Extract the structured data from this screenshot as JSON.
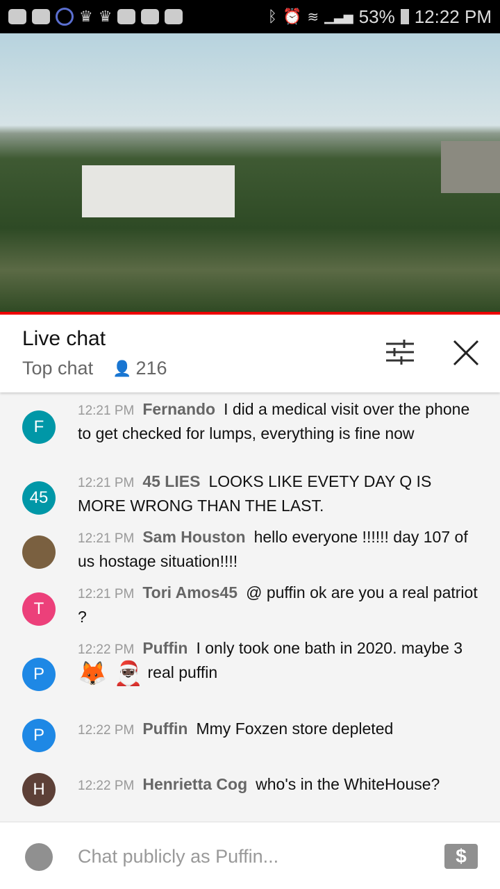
{
  "status_bar": {
    "battery": "53%",
    "time": "12:22 PM",
    "icons": [
      "youtube-icon",
      "alert-icon",
      "pokeball-icon",
      "crown-icon",
      "crown-icon",
      "m-app-icon",
      "youtube-icon",
      "folder-icon",
      "bluetooth-icon",
      "alarm-icon",
      "wifi-icon",
      "signal-icon",
      "battery-icon"
    ]
  },
  "header": {
    "title": "Live chat",
    "mode": "Top chat",
    "viewers": "216"
  },
  "messages": [
    {
      "initial": "F",
      "color": "#0097a7",
      "time": "12:21 PM",
      "author": "Fernando",
      "text": "I did a medical visit over the phone to get checked for lumps, everything is fine now"
    },
    {
      "initial": "45",
      "color": "#0097a7",
      "time": "12:21 PM",
      "author": "45 LIES",
      "text": "LOOKS LIKE EVETY DAY Q IS MORE WRONG THAN THE LAST."
    },
    {
      "initial": "",
      "color": "#7a6040",
      "time": "12:21 PM",
      "author": "Sam Houston",
      "text": "hello everyone !!!!!! day 107 of us hostage situation!!!!"
    },
    {
      "initial": "T",
      "color": "#ec407a",
      "time": "12:21 PM",
      "author": "Tori Amos45",
      "text": "@ puffin ok are you a real patriot ?"
    },
    {
      "initial": "P",
      "color": "#1e88e5",
      "time": "12:22 PM",
      "author": "Puffin",
      "text": "I only took one bath in 2020. maybe 3",
      "emoji": "🦊 🎅🏿",
      "text2": "real puffin"
    },
    {
      "initial": "P",
      "color": "#1e88e5",
      "time": "12:22 PM",
      "author": "Puffin",
      "text": "Mmy Foxzen store depleted"
    },
    {
      "initial": "H",
      "color": "#5d4037",
      "time": "12:22 PM",
      "author": "Henrietta Cog",
      "text": "who's in the WhiteHouse?"
    }
  ],
  "input": {
    "placeholder": "Chat publicly as Puffin..."
  }
}
